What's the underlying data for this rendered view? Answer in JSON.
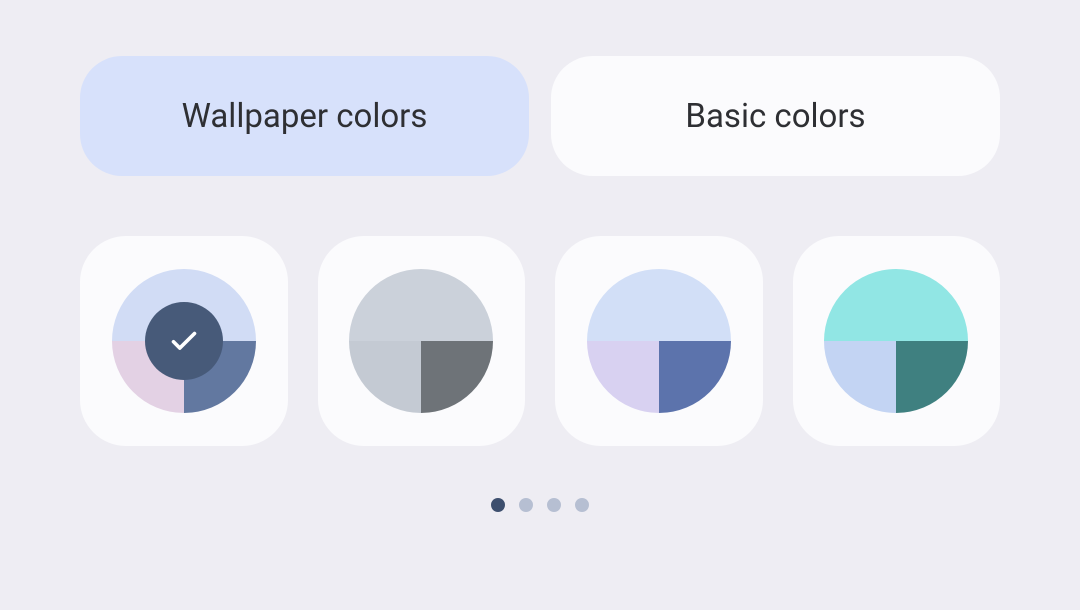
{
  "tabs": [
    {
      "id": "wallpaper",
      "label": "Wallpaper colors",
      "active": true
    },
    {
      "id": "basic",
      "label": "Basic colors",
      "active": false
    }
  ],
  "swatches": [
    {
      "id": "palette-1",
      "selected": true,
      "colors": {
        "top": "#d1dcf5",
        "bottomLeft": "#e3d1e4",
        "bottomRight": "#6278a0"
      },
      "overlay": "#475a79"
    },
    {
      "id": "palette-2",
      "selected": false,
      "colors": {
        "top": "#cbd1da",
        "bottomLeft": "#c4cad3",
        "bottomRight": "#6e7378"
      }
    },
    {
      "id": "palette-3",
      "selected": false,
      "colors": {
        "top": "#d2dff7",
        "bottomLeft": "#d8d1f1",
        "bottomRight": "#5c73ac"
      }
    },
    {
      "id": "palette-4",
      "selected": false,
      "colors": {
        "top": "#91e6e4",
        "bottomLeft": "#c3d4f3",
        "bottomRight": "#3f8080"
      }
    }
  ],
  "pagination": {
    "count": 4,
    "activeIndex": 0
  },
  "colors": {
    "pageBg": "#eeedf3",
    "cardBg": "#fbfbfd",
    "tabActiveBg": "#d7e1fb",
    "tabInactiveBg": "#fbfbfd",
    "dot": "#b6bfd2",
    "dotActive": "#3d4f6e"
  }
}
